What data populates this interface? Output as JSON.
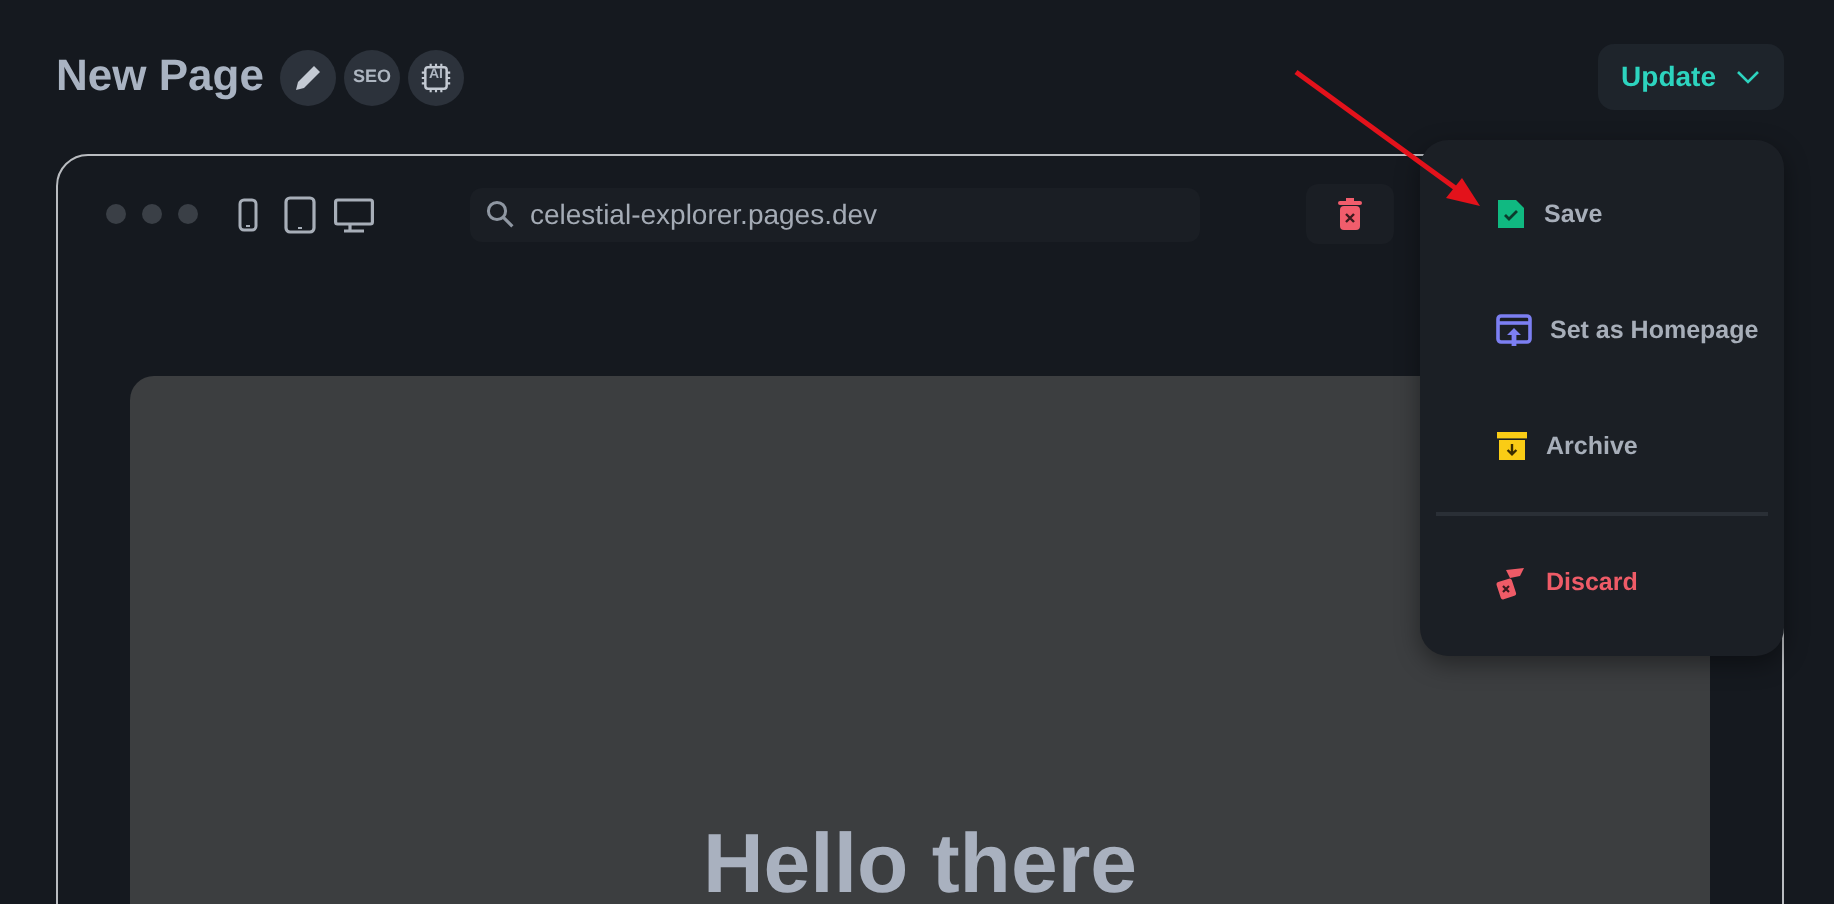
{
  "header": {
    "title": "New Page",
    "badges": [
      {
        "kind": "edit"
      },
      {
        "kind": "seo",
        "label": "SEO"
      },
      {
        "kind": "ai",
        "label": "AI"
      }
    ],
    "update_button": {
      "label": "Update",
      "expanded": true
    }
  },
  "preview": {
    "devices": [
      {
        "kind": "phone"
      },
      {
        "kind": "tablet"
      },
      {
        "kind": "desktop"
      }
    ],
    "address": "celestial-explorer.pages.dev",
    "heading": "Hello there"
  },
  "menu": {
    "items": [
      {
        "kind": "save",
        "label": "Save"
      },
      {
        "kind": "homepage",
        "label": "Set as Homepage"
      },
      {
        "kind": "archive",
        "label": "Archive"
      },
      {
        "kind": "discard",
        "label": "Discard"
      }
    ]
  }
}
